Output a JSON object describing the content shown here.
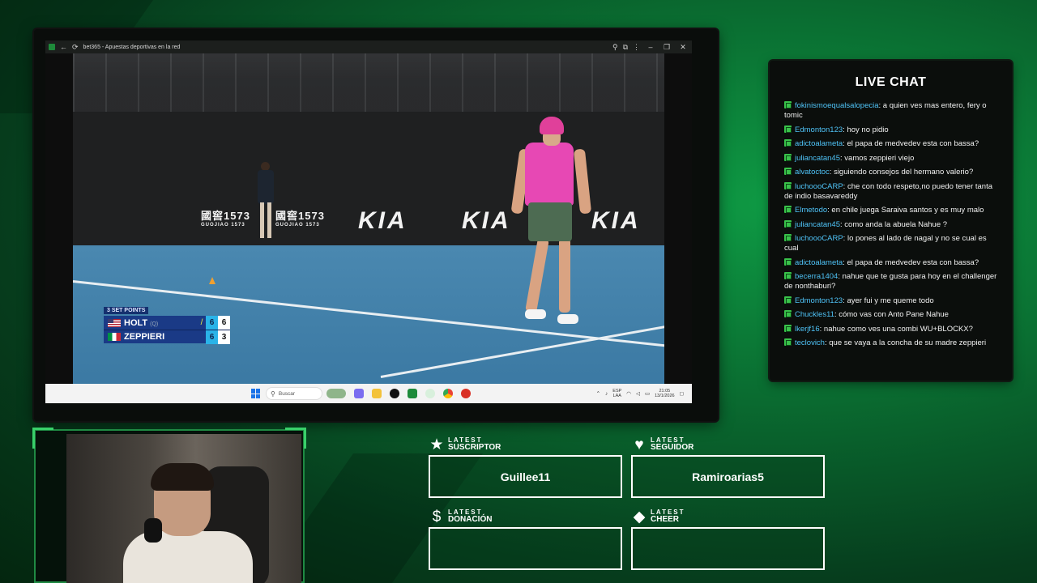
{
  "browser": {
    "tab_title": "bet365 - Apuestas deportivas en la red"
  },
  "video": {
    "sponsors": {
      "guo_1": "國窖1573",
      "guo_1_sub": "GUOJIAO 1573",
      "guo_2": "國窖1573",
      "guo_2_sub": "GUOJIAO 1573",
      "kia": "KIA"
    },
    "scoreboard": {
      "tag": "3 SET POINTS",
      "players": [
        {
          "name": "HOLT",
          "seed": "(Q)",
          "serving": true,
          "set1": "6",
          "set2": "6"
        },
        {
          "name": "ZEPPIERI",
          "seed": "",
          "serving": false,
          "set1": "6",
          "set2": "3"
        }
      ]
    }
  },
  "taskbar": {
    "search_placeholder": "Buscar",
    "lang_line1": "ESP",
    "lang_line2": "LAA",
    "time": "21:05",
    "date": "13/1/2026"
  },
  "chat": {
    "title": "LIVE CHAT",
    "messages": [
      {
        "user": "fokinismoequalsalopecia",
        "text": "a quien ves mas entero, fery o tomic"
      },
      {
        "user": "Edmonton123",
        "text": "hoy no pidio"
      },
      {
        "user": "adictoalameta",
        "text": "el papa de medvedev esta con bassa?"
      },
      {
        "user": "juliancatan45",
        "text": "vamos zeppieri viejo"
      },
      {
        "user": "alvatoctoc",
        "text": "siguiendo consejos del hermano valerio?"
      },
      {
        "user": "luchoooCARP",
        "text": "che con todo respeto,no puedo tener tanta de indio basavareddy"
      },
      {
        "user": "Elmetodo",
        "text": "en chile juega Saraiva santos y es muy malo"
      },
      {
        "user": "juliancatan45",
        "text": "como anda la abuela Nahue ?"
      },
      {
        "user": "luchoooCARP",
        "text": "lo pones al lado de nagal y no se cual es cual"
      },
      {
        "user": "adictoalameta",
        "text": "el papa de medvedev esta con bassa?"
      },
      {
        "user": "becerra1404",
        "text": "nahue que te gusta para hoy en el challenger de nonthaburi?"
      },
      {
        "user": "Edmonton123",
        "text": "ayer fui y me queme todo"
      },
      {
        "user": "Chuckles11",
        "text": "cómo vas con Anto Pane Nahue"
      },
      {
        "user": "lkerjf16",
        "text": "nahue como ves una combi WU+BLOCKX?"
      },
      {
        "user": "teclovich",
        "text": "que se vaya a la concha de su madre zeppieri"
      }
    ]
  },
  "latest": {
    "subscriptor": {
      "small": "LATEST",
      "big": "SUSCRIPTOR",
      "value": "Guillee11"
    },
    "seguidor": {
      "small": "LATEST",
      "big": "SEGUIDOR",
      "value": "Ramiroarias5"
    },
    "donacion": {
      "small": "LATEST",
      "big": "DONACIÓN",
      "value": ""
    },
    "cheer": {
      "small": "LATEST",
      "big": "CHEER",
      "value": ""
    }
  }
}
